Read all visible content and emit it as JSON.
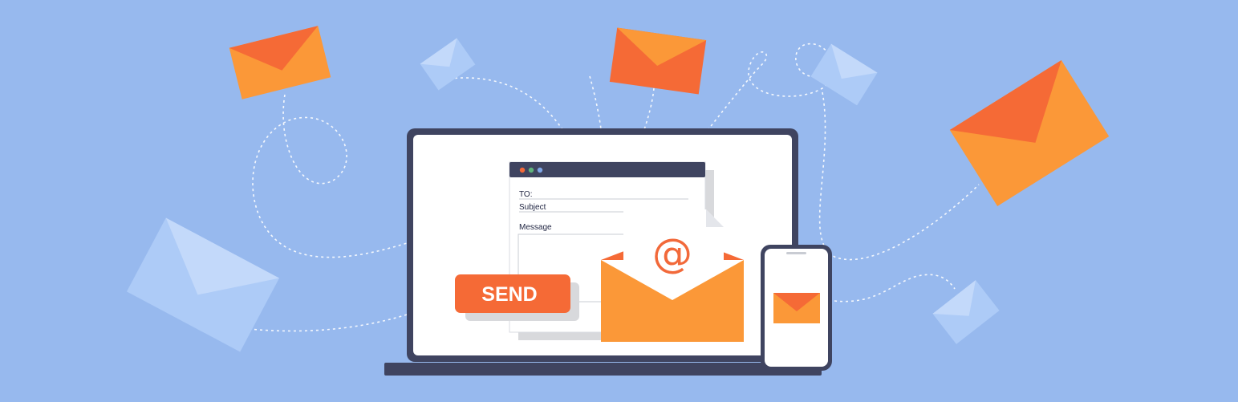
{
  "illustration": {
    "colors": {
      "background": "#97b9ee",
      "envelope_orange": "#fb9838",
      "envelope_flap": "#f56a36",
      "envelope_light": "#adcbf7",
      "laptop_frame": "#3f4460",
      "screen": "#ffffff",
      "dotted_path": "#ffffff"
    },
    "email_window": {
      "to_label": "TO:",
      "subject_label": "Subject",
      "message_label": "Message",
      "dot_colors": [
        "#f2693a",
        "#5fb37b",
        "#7fa6e6"
      ]
    },
    "send_button": {
      "label": "SEND"
    },
    "open_envelope": {
      "symbol": "@",
      "icon": "at-sign-icon"
    },
    "phone": {
      "icon": "envelope-icon"
    }
  }
}
